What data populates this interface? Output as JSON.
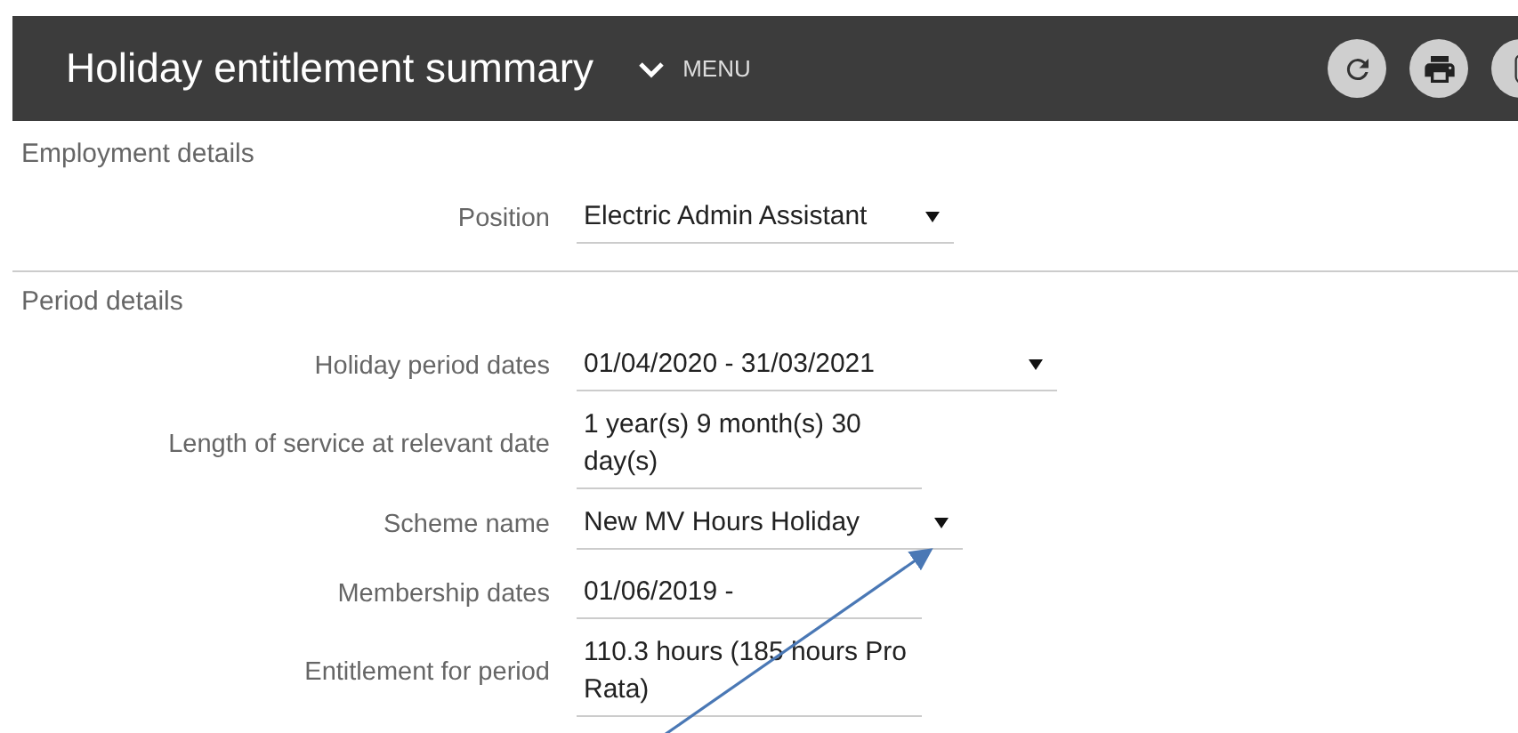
{
  "header": {
    "title": "Holiday entitlement summary",
    "menu_label": "MENU"
  },
  "sections": [
    {
      "title": "Employment details",
      "fields": [
        {
          "label": "Position",
          "value": "Electric Admin Assistant",
          "kind": "select"
        }
      ]
    },
    {
      "title": "Period details",
      "fields": [
        {
          "label": "Holiday period dates",
          "value": "01/04/2020 - 31/03/2021",
          "kind": "select"
        },
        {
          "label": "Length of service at relevant date",
          "value": "1 year(s) 9 month(s) 30 day(s)",
          "kind": "text"
        },
        {
          "label": "Scheme name",
          "value": "New MV Hours Holiday",
          "kind": "select"
        },
        {
          "label": "Membership dates",
          "value": "01/06/2019 -",
          "kind": "text"
        },
        {
          "label": "Entitlement for period",
          "value": "110.3 hours (185 hours Pro Rata)",
          "kind": "text"
        }
      ]
    }
  ]
}
